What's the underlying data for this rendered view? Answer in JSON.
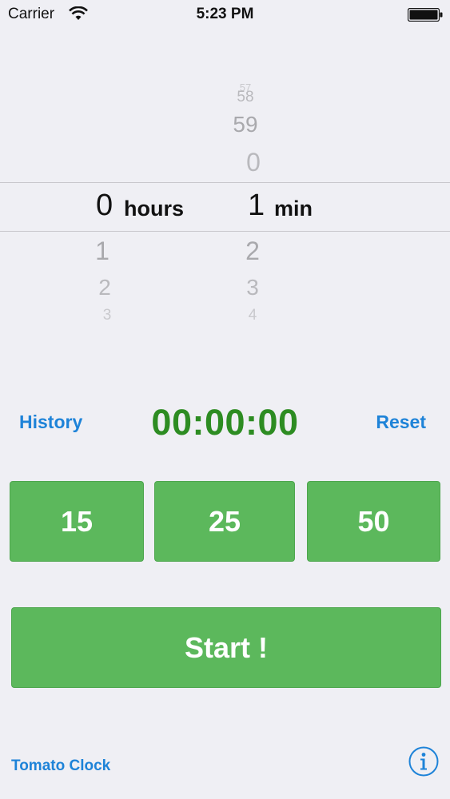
{
  "status_bar": {
    "carrier": "Carrier",
    "time": "5:23 PM",
    "wifi_icon": "wifi-icon",
    "battery_icon": "battery-icon"
  },
  "picker": {
    "hours": {
      "above": [],
      "selected": "0",
      "below": [
        "1",
        "2",
        "3"
      ],
      "unit": "hours"
    },
    "minutes": {
      "above": [
        "57",
        "58",
        "59",
        "0"
      ],
      "selected": "1",
      "below": [
        "2",
        "3",
        "4"
      ],
      "unit": "min"
    }
  },
  "controls": {
    "history_label": "History",
    "timer": "00:00:00",
    "reset_label": "Reset"
  },
  "presets": [
    "15",
    "25",
    "50"
  ],
  "start_label": "Start !",
  "footer": {
    "app_name": "Tomato Clock",
    "info_icon": "info-icon"
  },
  "colors": {
    "accent_blue": "#1e83d8",
    "button_green": "#5cb85c",
    "timer_green": "#2d8c22",
    "background": "#efeff4"
  }
}
